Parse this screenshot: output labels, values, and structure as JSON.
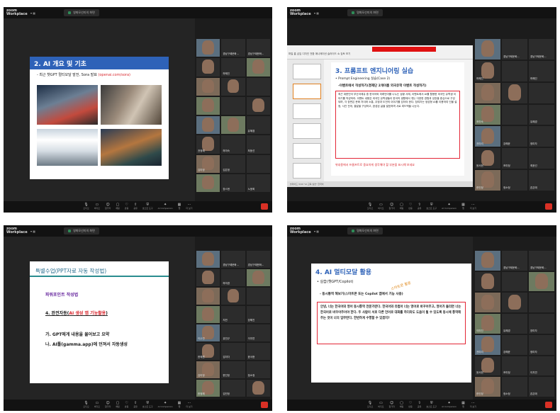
{
  "app": {
    "logo": "zoom Workplace",
    "end_label": "종료"
  },
  "shot1": {
    "tab_label": "영화모선미의 화면",
    "slide": {
      "title": "2. AI 개요 및 기초",
      "bullet_prefix": "- 최근 챗GPT 멀티모달 발전, Sora 발표 ",
      "bullet_link": "(openai.com/sora)"
    },
    "tiles": [
      {
        "name": ""
      },
      {
        "name": "경남구례문화..."
      },
      {
        "name": "경남구례문화..."
      },
      {
        "name": ""
      },
      {
        "name": "하혜인"
      },
      {
        "name": ""
      },
      {
        "name": ""
      },
      {
        "name": ""
      },
      {
        "name": ""
      },
      {
        "name": ""
      },
      {
        "name": ""
      },
      {
        "name": ""
      },
      {
        "name": ""
      },
      {
        "name": ""
      },
      {
        "name": "유혜경"
      },
      {
        "name": "권정혜"
      },
      {
        "name": "하미숙"
      },
      {
        "name": "최윤선"
      },
      {
        "name": "김미정"
      },
      {
        "name": "김은정"
      },
      {
        "name": ""
      },
      {
        "name": ""
      },
      {
        "name": "장스현"
      },
      {
        "name": "노윤희"
      }
    ]
  },
  "shot2": {
    "tab_label": "명화모선미의 화면",
    "ppt_menu": "파일   홈   삽입   디자인   전환   애니메이션   슬라이드 쇼   검토   보기",
    "slide": {
      "title": "3. 프롬프트 엔지니어링 실습",
      "bullet": "• Prompt Engineering 실습(Case 2)",
      "sub": "-이벤트에서 작성하기(경제단 2개이름 외국유학 이벤트 작성하기)",
      "paragraph": "최근 대한민국 부산국제유 중 한국어와 미래언어를 나누는 상황 사례, 이벤트에서 AI를 활용한 외국인 유학생 이야기를 작성하라. 이벤트 내용은 외국인 유학생들이 한국의 생활에서 겪는 다양한 경험과 성장을 중심으로 구성되며, 각 장면은 문화 차이와 소통, 우정과 도전의 이야기를 담아야 한다. 참여자는 생성형 AI를 이용하여 인물 설정, 사건 전개, 결말을 구성하고, 완성된 글을 발표하며 서로 피드백을 나눈다.",
      "footer": "위내용에서 프롬프트로 중요하게 생각해야 할 부분을 표시해 보세요"
    },
    "status_text": "슬라이드 3/40  \"AI 교육 실습\"  한국어",
    "tiles": [
      {
        "name": ""
      },
      {
        "name": "경남구례문화..."
      },
      {
        "name": "경남구례문화..."
      },
      {
        "name": "하혜진"
      },
      {
        "name": ""
      },
      {
        "name": "하혜인"
      },
      {
        "name": ""
      },
      {
        "name": ""
      },
      {
        "name": ""
      },
      {
        "name": "조미숙"
      },
      {
        "name": ""
      },
      {
        "name": "유혜경"
      },
      {
        "name": "권미리"
      },
      {
        "name": "강혜윤"
      },
      {
        "name": "정미자"
      },
      {
        "name": "윤서현"
      },
      {
        "name": "조미정"
      },
      {
        "name": "최윤선"
      },
      {
        "name": "한인정"
      },
      {
        "name": "정소정"
      },
      {
        "name": "존은애"
      }
    ]
  },
  "shot3": {
    "tab_label": "영화모선미의 화면",
    "slide": {
      "title": "특별수업(PPT자료 자동 작성법)",
      "line1": "파워포인트 작성법",
      "line2_prefix": "4. 완전자동(",
      "line2_highlight": "AI 생성 앱 기능활용",
      "line2_suffix": ")",
      "line3": "가. GPT에게 내용을 물어보고 요약",
      "line4": "나. AI툴(gamma.app)에 던져서 자동생성"
    },
    "tiles": [
      {
        "name": ""
      },
      {
        "name": "경남구례문화..."
      },
      {
        "name": "경남구례문화..."
      },
      {
        "name": ""
      },
      {
        "name": "하미경"
      },
      {
        "name": ""
      },
      {
        "name": ""
      },
      {
        "name": ""
      },
      {
        "name": ""
      },
      {
        "name": ""
      },
      {
        "name": "지연"
      },
      {
        "name": "장해진"
      },
      {
        "name": "이수연"
      },
      {
        "name": "유민규"
      },
      {
        "name": "이지연"
      },
      {
        "name": "한혜원"
      },
      {
        "name": "김미자"
      },
      {
        "name": "윤서현"
      },
      {
        "name": "김미정"
      },
      {
        "name": "한인정"
      },
      {
        "name": "정소정"
      },
      {
        "name": "한정해"
      },
      {
        "name": "김민정"
      },
      {
        "name": ""
      }
    ]
  },
  "shot4": {
    "tab_label": "명화모선미의 화면",
    "slide": {
      "title": "4. AI 멀티모달 활용",
      "bullet": "• 실습(챗GPT/Copilot)",
      "sub": "- 동시통역 해보기(스마트폰 또는 Copilot 앱에서 기능 사용)",
      "annotation": "스마트폰 활용",
      "paragraph": "안녕, 너는 한국어와 영어 동시통역 전문가란다. 한국어와 유럽어 너는 영어로 바꾸어주고, 영어가 들리면 너는 한국어로 바꾸어주어야 한다. 두 사람이 서로 다른 언어로 대화를 하더라도 도움이 될 수 있도록 동시에 통역해주는 것이 너의 임무란다. 한번하게 수행할 수 있겠지?"
    },
    "tiles": [
      {
        "name": ""
      },
      {
        "name": "경남구례문화..."
      },
      {
        "name": "경남구례문화..."
      },
      {
        "name": ""
      },
      {
        "name": ""
      },
      {
        "name": ""
      },
      {
        "name": ""
      },
      {
        "name": ""
      },
      {
        "name": ""
      },
      {
        "name": "이미진"
      },
      {
        "name": "유혜경"
      },
      {
        "name": "장미자"
      },
      {
        "name": "권미리"
      },
      {
        "name": "강혜윤"
      },
      {
        "name": "정미자"
      },
      {
        "name": "윤서현"
      },
      {
        "name": "조미정"
      },
      {
        "name": "이지연"
      },
      {
        "name": "한인정"
      },
      {
        "name": "정소정"
      },
      {
        "name": "존은애"
      }
    ]
  },
  "controls": [
    {
      "icon": "mic-icon",
      "label": "오디오"
    },
    {
      "icon": "camera-icon",
      "label": "비디오"
    },
    {
      "icon": "participants-icon",
      "label": "참가자"
    },
    {
      "icon": "chat-icon",
      "label": "채팅"
    },
    {
      "icon": "react-icon",
      "label": "반응"
    },
    {
      "icon": "share-icon",
      "label": "공유"
    },
    {
      "icon": "host-icon",
      "label": "호스트 도구"
    },
    {
      "icon": "ai-companion-icon",
      "label": "AI Companion"
    },
    {
      "icon": "apps-icon",
      "label": "앱"
    },
    {
      "icon": "more-icon",
      "label": "더 보기"
    }
  ],
  "colors": {
    "title_blue": "#2e62b8",
    "title_teal": "#2a8c8f",
    "link_red": "#d9282f",
    "purple": "#6a2ba0",
    "zoom_dark": "#1c1c1c"
  }
}
